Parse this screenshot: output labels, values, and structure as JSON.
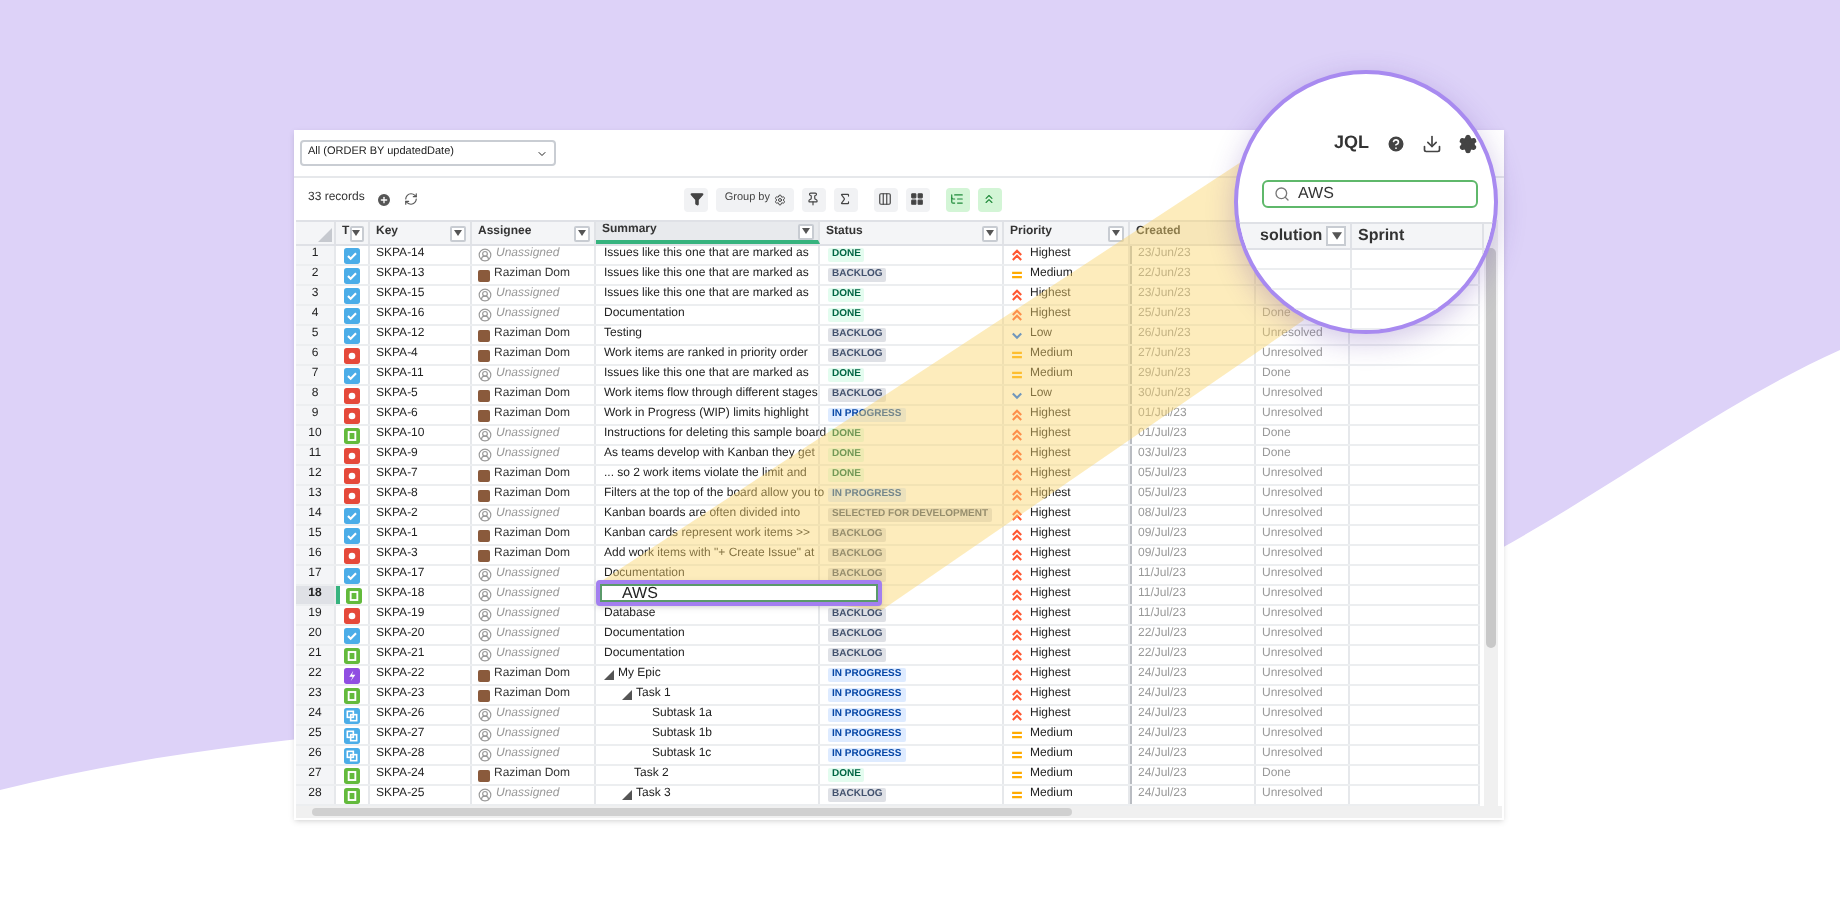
{
  "filter": {
    "value": "All (ORDER BY updatedDate)"
  },
  "toolbar": {
    "record_count": "33 records",
    "group_by": "Group by"
  },
  "columns": [
    {
      "label": "T",
      "filter_button": true,
      "selected": false
    },
    {
      "label": "Key",
      "filter_button": true,
      "selected": false
    },
    {
      "label": "Assignee",
      "filter_button": true,
      "selected": false
    },
    {
      "label": "Summary",
      "filter_button": true,
      "selected": true
    },
    {
      "label": "Status",
      "filter_button": true,
      "selected": false
    },
    {
      "label": "Priority",
      "filter_button": true,
      "selected": false
    },
    {
      "label": "Created",
      "filter_button": false,
      "selected": false
    }
  ],
  "rows": [
    {
      "number": "1",
      "kind": "task",
      "key": "SKPA-14",
      "assignee": {
        "kind": "unassigned",
        "name": "Unassigned"
      },
      "summary": "Issues like this one that are marked as",
      "status": {
        "label": "DONE",
        "kind": "done"
      },
      "priority": {
        "label": "Highest",
        "kind": "highest"
      },
      "created": "23/Jun/23",
      "selected": false
    },
    {
      "number": "2",
      "kind": "task",
      "key": "SKPA-13",
      "assignee": {
        "kind": "person",
        "name": "Raziman Dom"
      },
      "summary": "Issues like this one that are marked as",
      "status": {
        "label": "BACKLOG",
        "kind": "todo"
      },
      "priority": {
        "label": "Medium",
        "kind": "medium"
      },
      "created": "22/Jun/23",
      "selected": false
    },
    {
      "number": "3",
      "kind": "task",
      "key": "SKPA-15",
      "assignee": {
        "kind": "unassigned",
        "name": "Unassigned"
      },
      "summary": "Issues like this one that are marked as",
      "status": {
        "label": "DONE",
        "kind": "done"
      },
      "priority": {
        "label": "Highest",
        "kind": "highest"
      },
      "created": "23/Jun/23",
      "selected": false
    },
    {
      "number": "4",
      "kind": "task",
      "key": "SKPA-16",
      "assignee": {
        "kind": "unassigned",
        "name": "Unassigned"
      },
      "summary": "Documentation",
      "status": {
        "label": "DONE",
        "kind": "done"
      },
      "priority": {
        "label": "Highest",
        "kind": "highest"
      },
      "created": "25/Jun/23",
      "resolution": "Done",
      "selected": false
    },
    {
      "number": "5",
      "kind": "task",
      "key": "SKPA-12",
      "assignee": {
        "kind": "person",
        "name": "Raziman Dom"
      },
      "summary": "Testing",
      "status": {
        "label": "BACKLOG",
        "kind": "todo"
      },
      "priority": {
        "label": "Low",
        "kind": "low"
      },
      "created": "26/Jun/23",
      "resolution": "Unresolved",
      "selected": false
    },
    {
      "number": "6",
      "kind": "bug",
      "key": "SKPA-4",
      "assignee": {
        "kind": "person",
        "name": "Raziman Dom"
      },
      "summary": "Work items are ranked in priority order",
      "status": {
        "label": "BACKLOG",
        "kind": "todo"
      },
      "priority": {
        "label": "Medium",
        "kind": "medium"
      },
      "created": "27/Jun/23",
      "resolution": "Unresolved",
      "selected": false
    },
    {
      "number": "7",
      "kind": "task",
      "key": "SKPA-11",
      "assignee": {
        "kind": "unassigned",
        "name": "Unassigned"
      },
      "summary": "Issues like this one that are marked as",
      "status": {
        "label": "DONE",
        "kind": "done"
      },
      "priority": {
        "label": "Medium",
        "kind": "medium"
      },
      "created": "29/Jun/23",
      "resolution": "Done",
      "selected": false
    },
    {
      "number": "8",
      "kind": "bug",
      "key": "SKPA-5",
      "assignee": {
        "kind": "person",
        "name": "Raziman Dom"
      },
      "summary": "Work items flow through different stages",
      "status": {
        "label": "BACKLOG",
        "kind": "todo"
      },
      "priority": {
        "label": "Low",
        "kind": "low"
      },
      "created": "30/Jun/23",
      "resolution": "Unresolved",
      "selected": false
    },
    {
      "number": "9",
      "kind": "bug",
      "key": "SKPA-6",
      "assignee": {
        "kind": "person",
        "name": "Raziman Dom"
      },
      "summary": "Work in Progress (WIP) limits highlight",
      "status": {
        "label": "IN PROGRESS",
        "kind": "inprogress"
      },
      "priority": {
        "label": "Highest",
        "kind": "highest"
      },
      "created": "01/Jul/23",
      "resolution": "Unresolved",
      "selected": false
    },
    {
      "number": "10",
      "kind": "story",
      "key": "SKPA-10",
      "assignee": {
        "kind": "unassigned",
        "name": "Unassigned"
      },
      "summary": "Instructions for deleting this sample board",
      "status": {
        "label": "DONE",
        "kind": "done"
      },
      "priority": {
        "label": "Highest",
        "kind": "highest"
      },
      "created": "01/Jul/23",
      "resolution": "Done",
      "selected": false
    },
    {
      "number": "11",
      "kind": "bug",
      "key": "SKPA-9",
      "assignee": {
        "kind": "unassigned",
        "name": "Unassigned"
      },
      "summary": "As teams develop with Kanban they get",
      "status": {
        "label": "DONE",
        "kind": "done"
      },
      "priority": {
        "label": "Highest",
        "kind": "highest"
      },
      "created": "03/Jul/23",
      "resolution": "Done",
      "selected": false
    },
    {
      "number": "12",
      "kind": "bug",
      "key": "SKPA-7",
      "assignee": {
        "kind": "person",
        "name": "Raziman Dom"
      },
      "summary": "... so 2 work items violate the limit and",
      "status": {
        "label": "DONE",
        "kind": "done"
      },
      "priority": {
        "label": "Highest",
        "kind": "highest"
      },
      "created": "05/Jul/23",
      "resolution": "Unresolved",
      "selected": false
    },
    {
      "number": "13",
      "kind": "bug",
      "key": "SKPA-8",
      "assignee": {
        "kind": "person",
        "name": "Raziman Dom"
      },
      "summary": "Filters at the top of the board allow you to",
      "status": {
        "label": "IN PROGRESS",
        "kind": "inprogress"
      },
      "priority": {
        "label": "Highest",
        "kind": "highest"
      },
      "created": "05/Jul/23",
      "resolution": "Unresolved",
      "selected": false
    },
    {
      "number": "14",
      "kind": "task",
      "key": "SKPA-2",
      "assignee": {
        "kind": "unassigned",
        "name": "Unassigned"
      },
      "summary": "Kanban boards are often divided into",
      "status": {
        "label": "SELECTED FOR DEVELOPMENT",
        "kind": "todo"
      },
      "priority": {
        "label": "Highest",
        "kind": "highest"
      },
      "created": "08/Jul/23",
      "resolution": "Unresolved",
      "selected": false
    },
    {
      "number": "15",
      "kind": "task",
      "key": "SKPA-1",
      "assignee": {
        "kind": "person",
        "name": "Raziman Dom"
      },
      "summary": "Kanban cards represent work items >>",
      "status": {
        "label": "BACKLOG",
        "kind": "todo"
      },
      "priority": {
        "label": "Highest",
        "kind": "highest"
      },
      "created": "09/Jul/23",
      "resolution": "Unresolved",
      "selected": false
    },
    {
      "number": "16",
      "kind": "bug",
      "key": "SKPA-3",
      "assignee": {
        "kind": "person",
        "name": "Raziman Dom"
      },
      "summary": "Add work items with \"+ Create Issue\" at",
      "status": {
        "label": "BACKLOG",
        "kind": "todo"
      },
      "priority": {
        "label": "Highest",
        "kind": "highest"
      },
      "created": "09/Jul/23",
      "resolution": "Unresolved",
      "selected": false
    },
    {
      "number": "17",
      "kind": "task",
      "key": "SKPA-17",
      "assignee": {
        "kind": "unassigned",
        "name": "Unassigned"
      },
      "summary": "Documentation",
      "status": {
        "label": "BACKLOG",
        "kind": "todo"
      },
      "priority": {
        "label": "Highest",
        "kind": "highest"
      },
      "created": "11/Jul/23",
      "resolution": "Unresolved",
      "selected": false
    },
    {
      "number": "18",
      "kind": "story",
      "key": "SKPA-18",
      "assignee": {
        "kind": "unassigned",
        "name": "Unassigned"
      },
      "editing": {
        "value": "AWS"
      },
      "priority": {
        "label": "Highest",
        "kind": "highest"
      },
      "created": "11/Jul/23",
      "resolution": "Unresolved",
      "selected": true
    },
    {
      "number": "19",
      "kind": "bug",
      "key": "SKPA-19",
      "assignee": {
        "kind": "unassigned",
        "name": "Unassigned"
      },
      "summary": "Database",
      "status": {
        "label": "BACKLOG",
        "kind": "todo"
      },
      "priority": {
        "label": "Highest",
        "kind": "highest"
      },
      "created": "11/Jul/23",
      "resolution": "Unresolved",
      "selected": false
    },
    {
      "number": "20",
      "kind": "task",
      "key": "SKPA-20",
      "assignee": {
        "kind": "unassigned",
        "name": "Unassigned"
      },
      "summary": "Documentation",
      "status": {
        "label": "BACKLOG",
        "kind": "todo"
      },
      "priority": {
        "label": "Highest",
        "kind": "highest"
      },
      "created": "22/Jul/23",
      "resolution": "Unresolved",
      "selected": false
    },
    {
      "number": "21",
      "kind": "story",
      "key": "SKPA-21",
      "assignee": {
        "kind": "unassigned",
        "name": "Unassigned"
      },
      "summary": "Documentation",
      "status": {
        "label": "BACKLOG",
        "kind": "todo"
      },
      "priority": {
        "label": "Highest",
        "kind": "highest"
      },
      "created": "22/Jul/23",
      "resolution": "Unresolved",
      "selected": false
    },
    {
      "number": "22",
      "kind": "epic",
      "key": "SKPA-22",
      "assignee": {
        "kind": "person",
        "name": "Raziman Dom"
      },
      "summary": "My Epic",
      "status": {
        "label": "IN PROGRESS",
        "kind": "inprogress"
      },
      "priority": {
        "label": "Highest",
        "kind": "highest"
      },
      "created": "24/Jul/23",
      "resolution": "Unresolved",
      "selected": false,
      "expanded": true,
      "children": [
        {
          "number": "23",
          "kind": "story",
          "key": "SKPA-23",
          "assignee": {
            "kind": "person",
            "name": "Raziman Dom"
          },
          "summary": "Task 1",
          "status": {
            "label": "IN PROGRESS",
            "kind": "inprogress"
          },
          "priority": {
            "label": "Highest",
            "kind": "highest"
          },
          "created": "24/Jul/23",
          "resolution": "Unresolved",
          "selected": false,
          "expanded": true,
          "children": [
            {
              "number": "24",
              "kind": "subtask",
              "key": "SKPA-26",
              "assignee": {
                "kind": "unassigned",
                "name": "Unassigned"
              },
              "summary": "Subtask 1a",
              "status": {
                "label": "IN PROGRESS",
                "kind": "inprogress"
              },
              "priority": {
                "label": "Highest",
                "kind": "highest"
              },
              "created": "24/Jul/23",
              "resolution": "Unresolved",
              "selected": false
            },
            {
              "number": "25",
              "kind": "subtask",
              "key": "SKPA-27",
              "assignee": {
                "kind": "unassigned",
                "name": "Unassigned"
              },
              "summary": "Subtask 1b",
              "status": {
                "label": "IN PROGRESS",
                "kind": "inprogress"
              },
              "priority": {
                "label": "Medium",
                "kind": "medium"
              },
              "created": "24/Jul/23",
              "resolution": "Unresolved",
              "selected": false
            },
            {
              "number": "26",
              "kind": "subtask",
              "key": "SKPA-28",
              "assignee": {
                "kind": "unassigned",
                "name": "Unassigned"
              },
              "summary": "Subtask 1c",
              "status": {
                "label": "IN PROGRESS",
                "kind": "inprogress"
              },
              "priority": {
                "label": "Medium",
                "kind": "medium"
              },
              "created": "24/Jul/23",
              "resolution": "Unresolved",
              "selected": false
            }
          ]
        },
        {
          "number": "27",
          "kind": "story",
          "key": "SKPA-24",
          "assignee": {
            "kind": "person",
            "name": "Raziman Dom"
          },
          "summary": "Task 2",
          "status": {
            "label": "DONE",
            "kind": "done"
          },
          "priority": {
            "label": "Medium",
            "kind": "medium"
          },
          "created": "24/Jul/23",
          "resolution": "Done",
          "selected": false
        },
        {
          "number": "28",
          "kind": "story",
          "key": "SKPA-25",
          "assignee": {
            "kind": "unassigned",
            "name": "Unassigned"
          },
          "summary": "Task 3",
          "status": {
            "label": "BACKLOG",
            "kind": "todo"
          },
          "priority": {
            "label": "Medium",
            "kind": "medium"
          },
          "created": "24/Jul/23",
          "resolution": "Unresolved",
          "selected": false,
          "expanded": true
        }
      ]
    }
  ],
  "magnifier": {
    "jql": "JQL",
    "search": {
      "value": "AWS"
    },
    "columns": [
      {
        "label": "solution",
        "filter_button": true
      },
      {
        "label": "Sprint",
        "filter_button": false
      }
    ]
  }
}
